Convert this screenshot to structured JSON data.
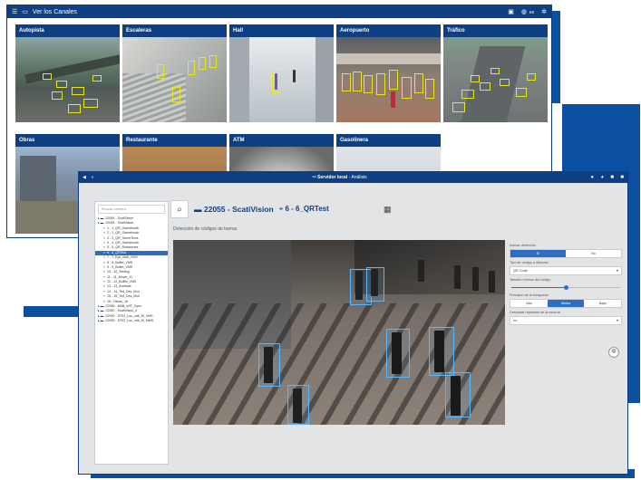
{
  "back_window": {
    "title": "Ver los Canales",
    "icons": [
      "menu-icon",
      "monitor-icon",
      "save-icon",
      "globe-icon",
      "gear-icon"
    ],
    "language": "es",
    "tiles": [
      {
        "label": "Autopista"
      },
      {
        "label": "Escaleras"
      },
      {
        "label": "Hall"
      },
      {
        "label": "Aeropuerto"
      },
      {
        "label": "Tráfico"
      },
      {
        "label": "Obras"
      },
      {
        "label": "Restaurante"
      },
      {
        "label": "ATM"
      },
      {
        "label": "Gasolinera"
      }
    ]
  },
  "front_window": {
    "server_title": "Servidor local",
    "section": "Análisis",
    "search_placeholder": "Buscar cámara",
    "tree": [
      "22054 - ScatiTalent",
      "22055 - ScatiVision",
      "1 - 1_QR_Gamebooth",
      "2 - 2_QR_Gamebooth",
      "3 - 3_QR_StreetTerra",
      "4 - 4_QR_Gamebooth",
      "5 - 5_QR_Rotisseries",
      "6 - 6_QRTest",
      "7 - 7_Eye_Mall_VMS",
      "8 - 8_Buffet_VMS",
      "9 - 9_Buffet_VMS",
      "10 - 10_Testing",
      "11 - 11_Movie_11",
      "12 - 12_Buffet_VMS",
      "13 - 13_Andrade",
      "14 - 14_Ted_Des_Mov",
      "15 - 15_Ted_Des_Mov",
      "16 - Obras_18",
      "22056 - MAB_WIT_Sync",
      "22080 - ScatiVision_4",
      "22090 - ST02_Loc_vdb_M_VMS",
      "22095 - ST02_Loc_vdb_M_MMS"
    ],
    "selected_index": 7,
    "server_id": "22055 - ScatiVision",
    "camera_name": "6 - 6_QRTest",
    "section_title": "Detección de códigos de barras",
    "options": {
      "activate_label": "Activar detección",
      "activate_choices": [
        "Sí",
        "No"
      ],
      "activate_selected": 0,
      "code_type_label": "Tipo de código a detectar",
      "code_type_value": "QR Code",
      "min_size_label": "Tamaño mínimo del código",
      "min_size_level": 0.5,
      "precision_label": "Precisión de la búsqueda",
      "precision_choices": [
        "Alta",
        "Media",
        "Baja"
      ],
      "precision_selected": 1,
      "repeat_label": "Descartar repetidos de la escena",
      "repeat_value": "no"
    }
  }
}
